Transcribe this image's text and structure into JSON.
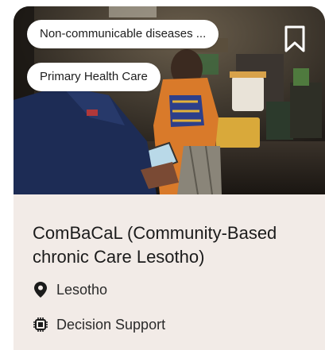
{
  "card": {
    "tags": [
      "Non-communicable diseases ...",
      "Primary Health Care"
    ],
    "title": "ComBaCaL (Community-Based chronic Care Lesotho)",
    "location": "Lesotho",
    "category": "Decision Support",
    "icons": {
      "bookmark": "bookmark-icon",
      "location": "map-pin-icon",
      "category": "cpu-chip-icon"
    },
    "colors": {
      "card_background": "#f2ebe7",
      "chip_background": "#ffffff",
      "text": "#1b1b1b"
    }
  }
}
